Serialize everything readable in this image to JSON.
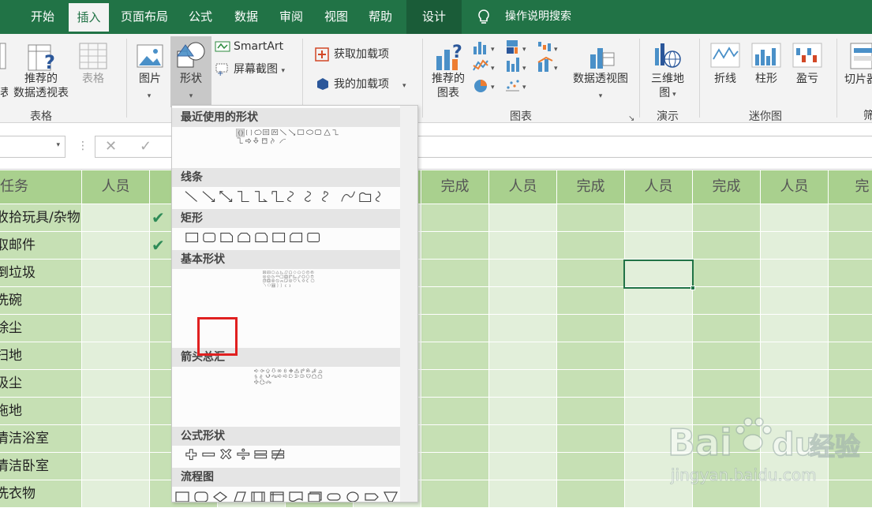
{
  "tabs": [
    {
      "label": "开始"
    },
    {
      "label": "插入"
    },
    {
      "label": "页面布局"
    },
    {
      "label": "公式"
    },
    {
      "label": "数据"
    },
    {
      "label": "审阅"
    },
    {
      "label": "视图"
    },
    {
      "label": "帮助"
    },
    {
      "label": "设计"
    }
  ],
  "tellme": "操作说明搜索",
  "ribbon": {
    "pivot_partial": "表",
    "recommended_pivot": [
      "推荐的",
      "数据透视表"
    ],
    "table": "表格",
    "picture": "图片",
    "shapes": "形状",
    "smartart": "SmartArt",
    "screenshot": "屏幕截图",
    "get_addins": "获取加载项",
    "my_addins": "我的加载项",
    "recommended_charts": [
      "推荐的",
      "图表"
    ],
    "pivot_chart": "数据透视图",
    "map3d": [
      "三维地",
      "图"
    ],
    "spark_line": "折线",
    "spark_column": "柱形",
    "spark_winloss": "盈亏",
    "slicer_partial": "切片器",
    "groups": {
      "tables": "表格",
      "charts": "图表",
      "tours": "演示",
      "sparklines": "迷你图",
      "filter_partial": "筛"
    }
  },
  "sheet": {
    "headers": [
      "任务",
      "人员",
      "完成",
      "人员",
      "完成",
      "人员",
      "完成",
      "人员",
      "完"
    ],
    "header_partial_c": "完",
    "tasks": [
      "收拾玩具/杂物",
      "取邮件",
      "倒垃圾",
      "洗碗",
      "除尘",
      "扫地",
      "吸尘",
      "拖地",
      "清洁浴室",
      "清洁卧室",
      "洗衣物"
    ],
    "checked_rows": [
      0,
      1
    ],
    "colors": {
      "header": "#a9d08e",
      "band1": "#c6e0b4",
      "band2": "#e2efda",
      "accent": "#217346"
    }
  },
  "shapes_menu": {
    "sections": [
      "最近使用的形状",
      "线条",
      "矩形",
      "基本形状",
      "箭头总汇",
      "公式形状",
      "流程图"
    ],
    "brace_glyphs": [
      "{",
      "}"
    ],
    "highlight_color": "#e02020"
  },
  "watermark": {
    "brand": "Bai",
    "brand2": "du",
    "cn": "经验",
    "url": "jingyan.baidu.com"
  }
}
